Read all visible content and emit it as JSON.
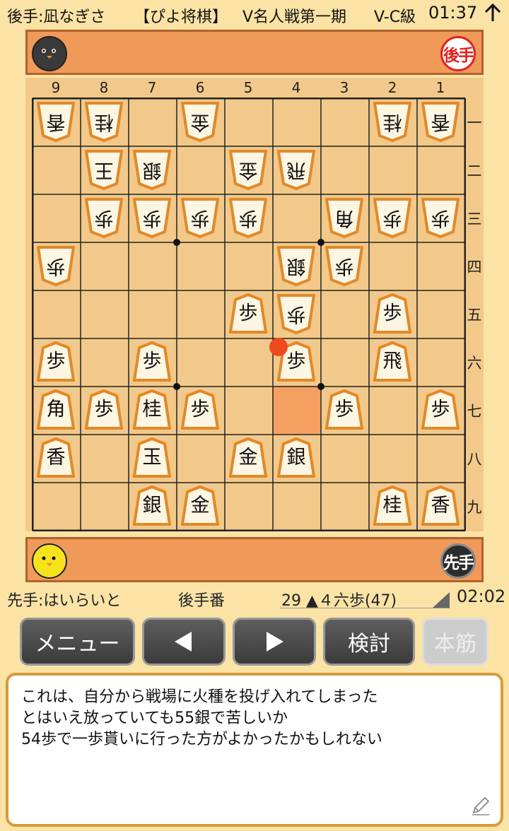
{
  "header": {
    "gote_player": "後手:凪なぎさ",
    "app_name": "【ぴよ将棋】",
    "event": "V名人戦第一期",
    "class": "V-C級",
    "clock": "01:37",
    "collapse_icon": "arrow-up-icon"
  },
  "gote_strip": {
    "avatar": "black-chick-avatar",
    "badge": "後手"
  },
  "sente_strip": {
    "avatar": "yellow-chick-avatar",
    "badge": "先手"
  },
  "board": {
    "file_labels": [
      "9",
      "8",
      "7",
      "6",
      "5",
      "4",
      "3",
      "2",
      "1"
    ],
    "rank_labels": [
      "一",
      "二",
      "三",
      "四",
      "五",
      "六",
      "七",
      "八",
      "九"
    ],
    "highlight_square": "47",
    "last_move_square": "46",
    "pieces": [
      {
        "sq": "91",
        "side": "gote",
        "char": "香"
      },
      {
        "sq": "81",
        "side": "gote",
        "char": "桂"
      },
      {
        "sq": "61",
        "side": "gote",
        "char": "金"
      },
      {
        "sq": "21",
        "side": "gote",
        "char": "桂"
      },
      {
        "sq": "11",
        "side": "gote",
        "char": "香"
      },
      {
        "sq": "82",
        "side": "gote",
        "char": "王"
      },
      {
        "sq": "72",
        "side": "gote",
        "char": "銀"
      },
      {
        "sq": "52",
        "side": "gote",
        "char": "金"
      },
      {
        "sq": "42",
        "side": "gote",
        "char": "飛"
      },
      {
        "sq": "83",
        "side": "gote",
        "char": "歩"
      },
      {
        "sq": "73",
        "side": "gote",
        "char": "歩"
      },
      {
        "sq": "63",
        "side": "gote",
        "char": "歩"
      },
      {
        "sq": "53",
        "side": "gote",
        "char": "歩"
      },
      {
        "sq": "33",
        "side": "gote",
        "char": "角"
      },
      {
        "sq": "23",
        "side": "gote",
        "char": "歩"
      },
      {
        "sq": "13",
        "side": "gote",
        "char": "歩"
      },
      {
        "sq": "94",
        "side": "gote",
        "char": "歩"
      },
      {
        "sq": "44",
        "side": "gote",
        "char": "銀"
      },
      {
        "sq": "34",
        "side": "gote",
        "char": "歩"
      },
      {
        "sq": "55",
        "side": "sente",
        "char": "歩"
      },
      {
        "sq": "45",
        "side": "gote",
        "char": "歩"
      },
      {
        "sq": "25",
        "side": "sente",
        "char": "歩"
      },
      {
        "sq": "96",
        "side": "sente",
        "char": "歩"
      },
      {
        "sq": "76",
        "side": "sente",
        "char": "歩"
      },
      {
        "sq": "46",
        "side": "sente",
        "char": "歩"
      },
      {
        "sq": "26",
        "side": "sente",
        "char": "飛"
      },
      {
        "sq": "97",
        "side": "sente",
        "char": "角"
      },
      {
        "sq": "87",
        "side": "sente",
        "char": "歩"
      },
      {
        "sq": "77",
        "side": "sente",
        "char": "桂"
      },
      {
        "sq": "67",
        "side": "sente",
        "char": "歩"
      },
      {
        "sq": "37",
        "side": "sente",
        "char": "歩"
      },
      {
        "sq": "17",
        "side": "sente",
        "char": "歩"
      },
      {
        "sq": "98",
        "side": "sente",
        "char": "香"
      },
      {
        "sq": "78",
        "side": "sente",
        "char": "玉"
      },
      {
        "sq": "58",
        "side": "sente",
        "char": "金"
      },
      {
        "sq": "48",
        "side": "sente",
        "char": "銀"
      },
      {
        "sq": "79",
        "side": "sente",
        "char": "銀"
      },
      {
        "sq": "69",
        "side": "sente",
        "char": "金"
      },
      {
        "sq": "29",
        "side": "sente",
        "char": "桂"
      },
      {
        "sq": "19",
        "side": "sente",
        "char": "香"
      }
    ]
  },
  "status": {
    "sente_player": "先手:はいらいと",
    "turn": "後手番",
    "move": "29 ▲４六歩(47)",
    "clock": "02:02"
  },
  "buttons": {
    "menu": "メニュー",
    "prev_icon": "triangle-left-icon",
    "next_icon": "triangle-right-icon",
    "analyze": "検討",
    "mainline": "本筋"
  },
  "comment": {
    "lines": [
      "これは、自分から戦場に火種を投げ入れてしまった",
      "とはいえ放っていても55銀で苦しいか",
      "54歩で一歩貰いに行った方がよかったかもしれない"
    ],
    "edit_icon": "pencil-icon"
  },
  "colors": {
    "background": "#fbe3a6",
    "strip": "#ef9a59",
    "board": "#f2c98a",
    "highlight": "#f3a061",
    "last_move_dot": "#ef4a1f",
    "piece_border": "#e0892a",
    "piece_face": "#fdf6e3",
    "comment_border": "#d79a3c",
    "gote_badge_red": "#e32020"
  }
}
